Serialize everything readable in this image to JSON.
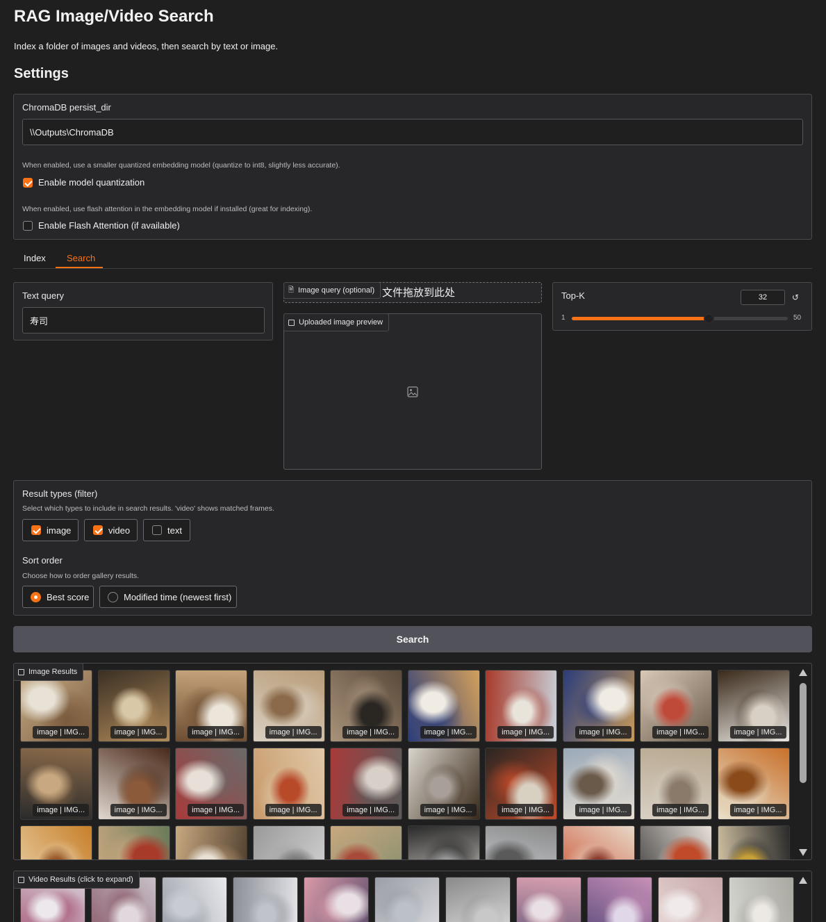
{
  "app": {
    "title": "RAG Image/Video Search",
    "subtitle": "Index a folder of images and videos, then search by text or image."
  },
  "settings": {
    "heading": "Settings",
    "persist_label": "ChromaDB persist_dir",
    "persist_value": "\\\\Outputs\\ChromaDB",
    "quant_help": "When enabled, use a smaller quantized embedding model (quantize to int8, slightly less accurate).",
    "quant_label": "Enable model quantization",
    "quant_checked": true,
    "flash_help": "When enabled, use flash attention in the embedding model if installed (great for indexing).",
    "flash_label": "Enable Flash Attention (if available)",
    "flash_checked": false
  },
  "tabs": [
    {
      "label": "Index",
      "active": false
    },
    {
      "label": "Search",
      "active": true
    }
  ],
  "search": {
    "text_query_label": "Text query",
    "text_query_value": "寿司",
    "image_query_label": "Image query (optional)",
    "image_query_drop": "文件拖放到此处",
    "preview_label": "Uploaded image preview",
    "topk_label": "Top-K",
    "topk_value": "32",
    "topk_min": "1",
    "topk_max": "50",
    "topk_fraction": 0.633,
    "filter_label": "Result types (filter)",
    "filter_help": "Select which types to include in search results. 'video' shows matched frames.",
    "filter_options": [
      {
        "label": "image",
        "checked": true
      },
      {
        "label": "video",
        "checked": true
      },
      {
        "label": "text",
        "checked": false
      }
    ],
    "sort_label": "Sort order",
    "sort_help": "Choose how to order gallery results.",
    "sort_options": [
      {
        "label": "Best score",
        "selected": true
      },
      {
        "label": "Modified time (newest first)",
        "selected": false
      }
    ],
    "search_button": "Search"
  },
  "image_results": {
    "label": "Image Results",
    "caption": "image | IMG...",
    "palettes": [
      [
        "#c9b08a",
        "#7a5a3c",
        "#e8e2d6"
      ],
      [
        "#3b3024",
        "#b08a5a",
        "#d8c8a8"
      ],
      [
        "#c4a27a",
        "#6e4e32",
        "#ece6da"
      ],
      [
        "#b89c78",
        "#d9cfc0",
        "#8a6a4a"
      ],
      [
        "#5a4a3a",
        "#a8927a",
        "#2a2622"
      ],
      [
        "#d4a05a",
        "#2a3c7a",
        "#f0ece4"
      ],
      [
        "#c8cfd8",
        "#a83a2a",
        "#e8e4dc"
      ],
      [
        "#c89a5a",
        "#2a3c7a",
        "#f0ece4"
      ],
      [
        "#6a5a4a",
        "#d8c8b8",
        "#c04a3a"
      ],
      [
        "#e8e6e2",
        "#3a2a1a",
        "#d8d0c4"
      ],
      [
        "#2a2a2a",
        "#8a6a4a",
        "#c8a880"
      ],
      [
        "#e0d8d0",
        "#4a2a1a",
        "#8a5a3a"
      ],
      [
        "#a83a3a",
        "#6a6a6a",
        "#e8e0d8"
      ],
      [
        "#c89a6a",
        "#e0c8a8",
        "#b84a2a"
      ],
      [
        "#a83a3a",
        "#5a5a5a",
        "#d8d0c8"
      ],
      [
        "#d8d4cc",
        "#3a2a1a",
        "#a8a098"
      ],
      [
        "#2a2622",
        "#c04a2a",
        "#d8d0c0"
      ],
      [
        "#9aa8b8",
        "#e8e0d4",
        "#6a5a4a"
      ],
      [
        "#b8a890",
        "#d8d0c4",
        "#8a7a6a"
      ],
      [
        "#c8702a",
        "#e8e0cc",
        "#8a4a1a"
      ],
      [
        "#c8802a",
        "#e8d0a8",
        "#9a5a2a"
      ],
      [
        "#6a7a5a",
        "#c8a880",
        "#a83a2a"
      ],
      [
        "#4a3a2a",
        "#c8a880",
        "#e8e0d4"
      ],
      [
        "#d8d8d8",
        "#9a9a9a",
        "#6a6a6a"
      ],
      [
        "#7a8a6a",
        "#c8a880",
        "#a84a3a"
      ],
      [
        "#e8e4de",
        "#2a2a2a",
        "#a8a8a8"
      ],
      [
        "#d8dce0",
        "#8a8a8a",
        "#5a5a5a"
      ],
      [
        "#c84a2a",
        "#e8d8c8",
        "#8a3a2a"
      ],
      [
        "#3a3a3a",
        "#e8e0d8",
        "#c04a2a"
      ],
      [
        "#d8c8a8",
        "#2a2a2a",
        "#c8a038"
      ]
    ]
  },
  "video_results": {
    "label": "Video Results (click to expand)",
    "palettes": [
      [
        "#d8d0d8",
        "#a85a7a",
        "#ece8ec"
      ],
      [
        "#c8c0c8",
        "#8a5a6a",
        "#e0d8dc"
      ],
      [
        "#e8e8ec",
        "#9aa0a8",
        "#c8ccd2"
      ],
      [
        "#e4e4e8",
        "#8a8e96",
        "#c0c4ca"
      ],
      [
        "#5a4a6a",
        "#d89aa8",
        "#e8e0e4"
      ],
      [
        "#e0e0e4",
        "#9a9ea6",
        "#bcc0c8"
      ],
      [
        "#e4e4e6",
        "#8a8a8a",
        "#c8c8c8"
      ],
      [
        "#6a5a7a",
        "#d8a0b0",
        "#e8e0e4"
      ],
      [
        "#5a4a7a",
        "#c890b8",
        "#e0d8e8"
      ],
      [
        "#e8d8d8",
        "#c8a8a8",
        "#f0eaea"
      ],
      [
        "#d8d8d4",
        "#a8a8a0",
        "#ece8e4"
      ]
    ]
  }
}
